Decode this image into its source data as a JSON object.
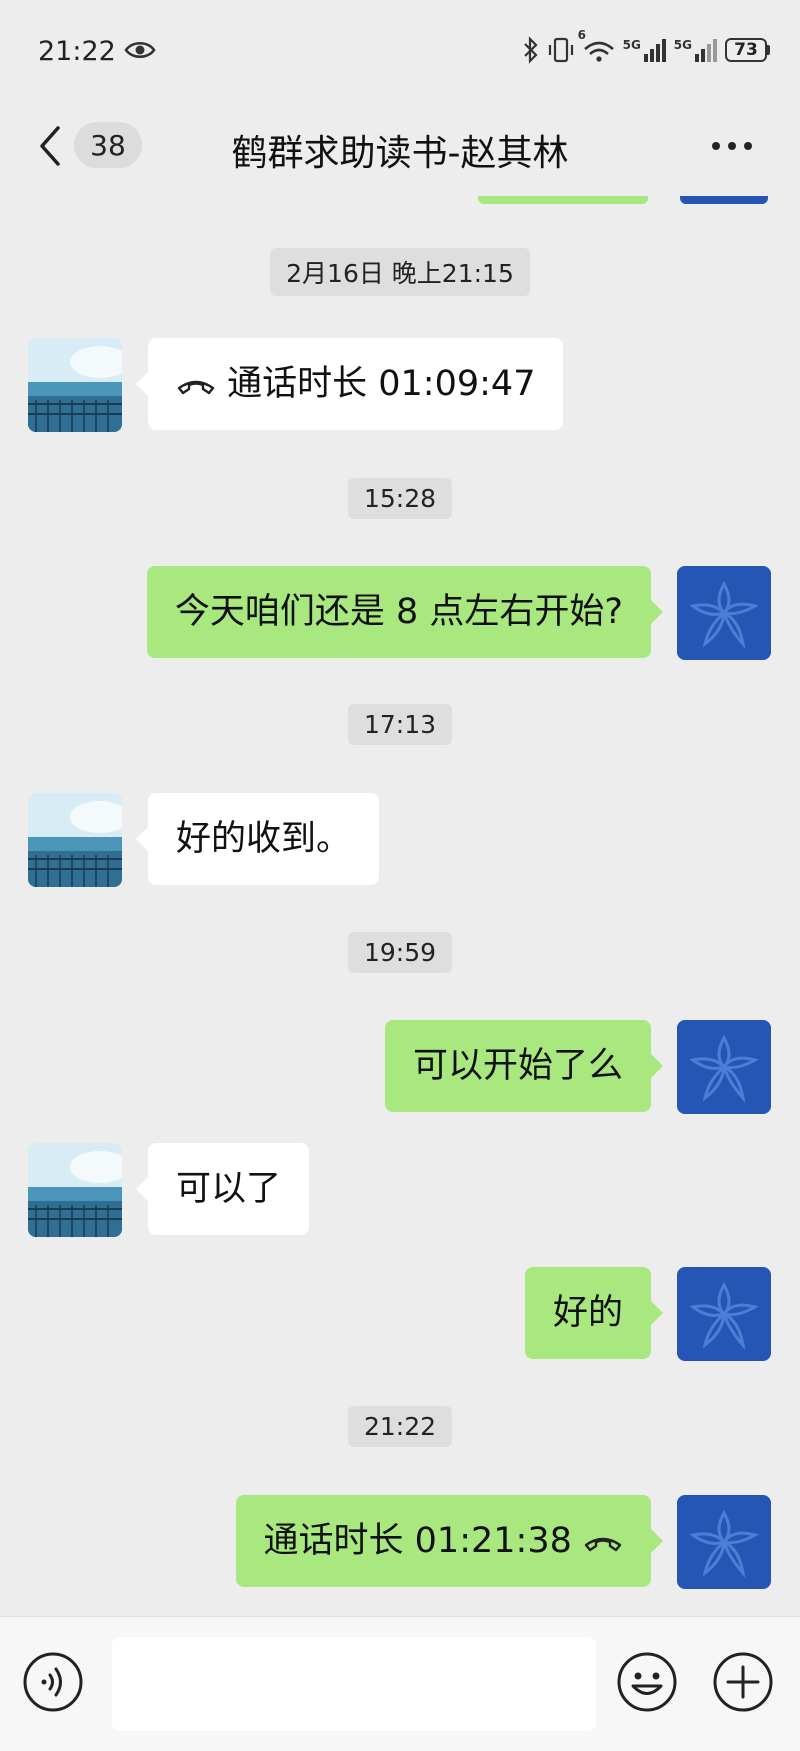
{
  "status_bar": {
    "time": "21:22",
    "battery": "73",
    "network_1": "5G",
    "network_2": "5G",
    "wifi_badge": "6"
  },
  "header": {
    "unread_count": "38",
    "title": "鹤群求助读书-赵其林"
  },
  "messages": {
    "ts1": "2月16日 晚上21:15",
    "call1": "通话时长 01:09:47",
    "ts2": "15:28",
    "msg1": "今天咱们还是 8 点左右开始?",
    "ts3": "17:13",
    "msg2": "好的收到。",
    "ts4": "19:59",
    "msg3": "可以开始了么",
    "msg4": "可以了",
    "msg5": "好的",
    "ts5": "21:22",
    "call2": "通话时长 01:21:38"
  },
  "colors": {
    "sent_bubble": "#a9e77f",
    "received_bubble": "#ffffff",
    "background": "#ededed",
    "self_avatar": "#2556b5"
  },
  "icons": {
    "back": "chevron-left-icon",
    "more": "more-icon",
    "call": "phone-hangup-icon",
    "voice": "voice-icon",
    "emoji": "emoji-icon",
    "plus": "plus-icon"
  }
}
